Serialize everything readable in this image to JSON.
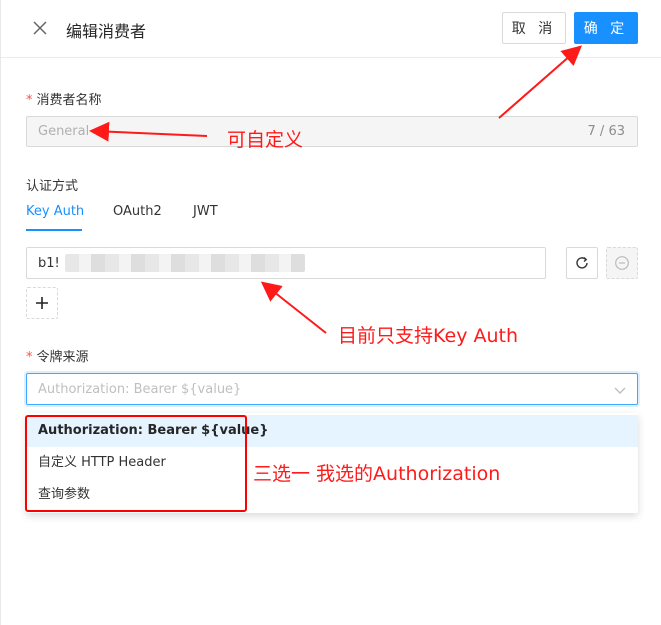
{
  "header": {
    "title": "编辑消费者",
    "cancel_label": "取 消",
    "ok_label": "确 定"
  },
  "consumer_name": {
    "label": "消费者名称",
    "required_mark": "*",
    "value": "General",
    "count": "7 / 63"
  },
  "auth": {
    "label": "认证方式",
    "tabs": [
      "Key Auth",
      "OAuth2",
      "JWT"
    ],
    "active_tab": "Key Auth",
    "key_value": "b1!",
    "add_label": "+"
  },
  "token_source": {
    "label": "令牌来源",
    "required_mark": "*",
    "placeholder": "Authorization: Bearer ${value}",
    "options": [
      "Authorization: Bearer ${value}",
      "自定义 HTTP Header",
      "查询参数"
    ],
    "selected_option": "Authorization: Bearer ${value}"
  },
  "annotations": {
    "custom": "可自定义",
    "only_key_auth": "目前只支持Key Auth",
    "choose_one": "三选一  我选的Authorization"
  },
  "colors": {
    "accent": "#1890ff",
    "annotation": "#ff1a1a",
    "required": "#ff4d4f"
  },
  "icons": [
    "close-icon",
    "refresh-icon",
    "minus-circle-icon",
    "plus-icon",
    "chevron-down-icon"
  ]
}
